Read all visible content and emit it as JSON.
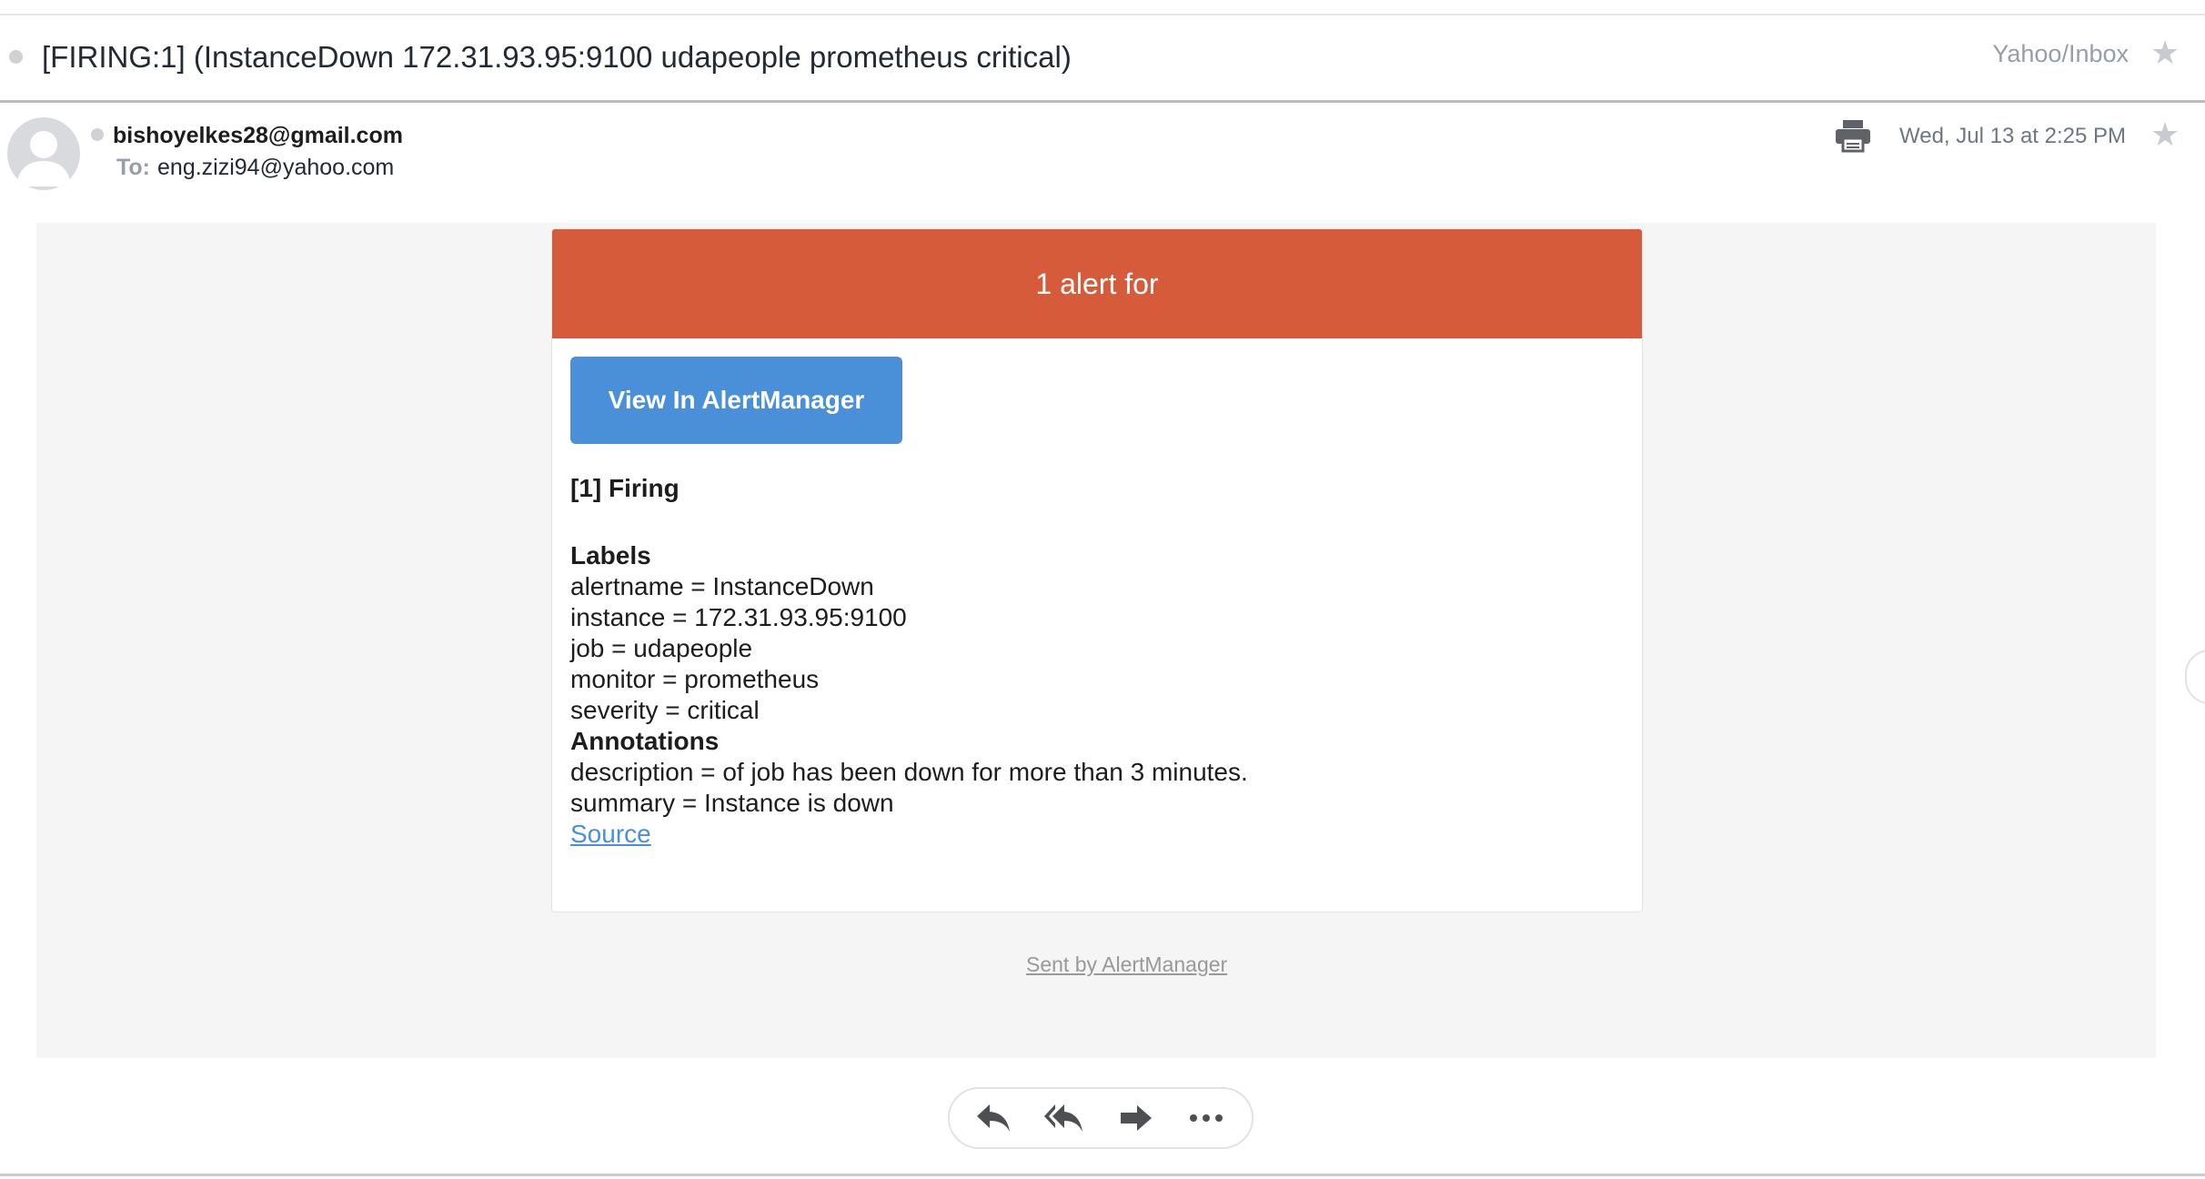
{
  "header": {
    "subject": "[FIRING:1] (InstanceDown 172.31.93.95:9100 udapeople prometheus critical)",
    "folder": "Yahoo/Inbox"
  },
  "message": {
    "sender": "bishoyelkes28@gmail.com",
    "to_label": "To:",
    "to_address": "eng.zizi94@yahoo.com",
    "date": "Wed, Jul 13 at 2:25 PM"
  },
  "alert": {
    "header_text": "1 alert for",
    "view_button": "View In AlertManager",
    "firing_title": "[1] Firing",
    "labels_title": "Labels",
    "labels": [
      "alertname = InstanceDown",
      "instance = 172.31.93.95:9100",
      "job = udapeople",
      "monitor = prometheus",
      "severity = critical"
    ],
    "annotations_title": "Annotations",
    "annotations": [
      "description = of job has been down for more than 3 minutes.",
      "summary = Instance is down"
    ],
    "source_link": "Source",
    "sent_by": "Sent by AlertManager"
  },
  "colors": {
    "alert_header": "#d65b3a",
    "button": "#4a90d9",
    "email_background": "#f5f5f5"
  },
  "icons": {
    "actions": [
      "reply-icon",
      "reply-all-icon",
      "forward-icon",
      "more-icon"
    ],
    "print": "printer-icon",
    "star": "star-icon"
  }
}
